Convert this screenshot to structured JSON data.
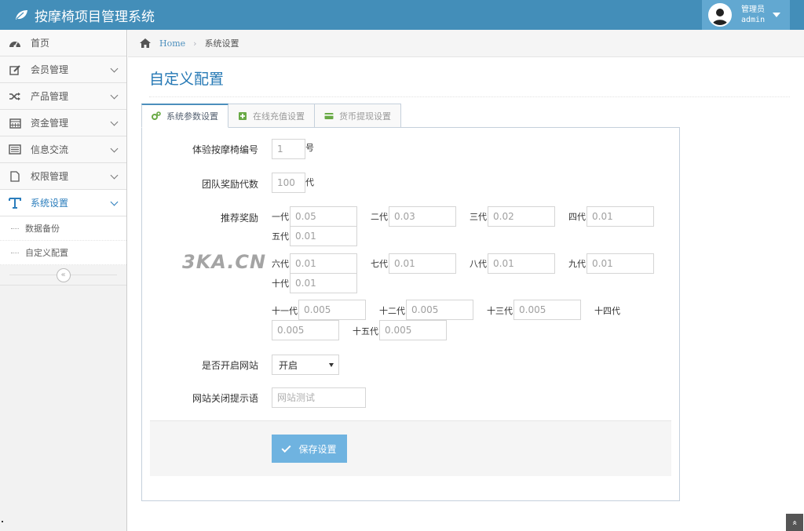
{
  "app": {
    "title": "按摩椅项目管理系统"
  },
  "user": {
    "role": "管理员",
    "name": "admin"
  },
  "sidebar": {
    "items": [
      {
        "label": "首页"
      },
      {
        "label": "会员管理"
      },
      {
        "label": "产品管理"
      },
      {
        "label": "资金管理"
      },
      {
        "label": "信息交流"
      },
      {
        "label": "权限管理"
      },
      {
        "label": "系统设置"
      }
    ],
    "sub_items": [
      {
        "label": "数据备份"
      },
      {
        "label": "自定义配置"
      }
    ],
    "collapse_glyph": "«"
  },
  "breadcrumb": {
    "home": "Home",
    "separator": "›",
    "current": "系统设置"
  },
  "page": {
    "title": "自定义配置"
  },
  "tabs": [
    {
      "label": "系统参数设置",
      "active": true
    },
    {
      "label": "在线充值设置",
      "active": false
    },
    {
      "label": "货币提现设置",
      "active": false
    }
  ],
  "form": {
    "trial_chair": {
      "label": "体验按摩椅编号",
      "value": "1",
      "unit": "号"
    },
    "team_levels": {
      "label": "团队奖励代数",
      "value": "100",
      "unit": "代"
    },
    "referral": {
      "label": "推荐奖励",
      "generations": [
        {
          "name": "一代",
          "value": "0.05"
        },
        {
          "name": "二代",
          "value": "0.03"
        },
        {
          "name": "三代",
          "value": "0.02"
        },
        {
          "name": "四代",
          "value": "0.01"
        },
        {
          "name": "五代",
          "value": "0.01"
        },
        {
          "name": "六代",
          "value": "0.01"
        },
        {
          "name": "七代",
          "value": "0.01"
        },
        {
          "name": "八代",
          "value": "0.01"
        },
        {
          "name": "九代",
          "value": "0.01"
        },
        {
          "name": "十代",
          "value": "0.01"
        },
        {
          "name": "十一代",
          "value": "0.005"
        },
        {
          "name": "十二代",
          "value": "0.005"
        },
        {
          "name": "十三代",
          "value": "0.005"
        },
        {
          "name": "十四代",
          "value": "0.005"
        },
        {
          "name": "十五代",
          "value": "0.005"
        }
      ]
    },
    "site_open": {
      "label": "是否开启网站",
      "value": "开启"
    },
    "close_msg": {
      "label": "网站关闭提示语",
      "placeholder": "网站测试"
    },
    "save_label": "保存设置"
  },
  "watermark": "3KA.CN",
  "scroll_top_glyph": "«"
}
